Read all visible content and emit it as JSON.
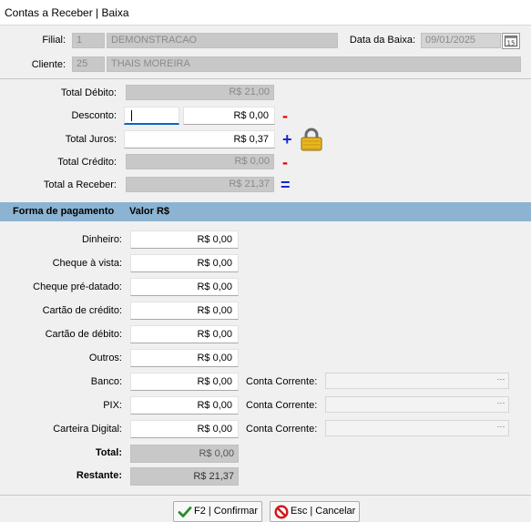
{
  "window": {
    "title": "Contas a Receber | Baixa"
  },
  "header": {
    "filial_label": "Filial:",
    "filial_code": "1",
    "filial_name": "DEMONSTRACAO",
    "data_label": "Data da Baixa:",
    "data_value": "09/01/2025",
    "calendar_text": "15",
    "cliente_label": "Cliente:",
    "cliente_code": "25",
    "cliente_name": "THAIS MOREIRA"
  },
  "totals": {
    "debito_label": "Total Débito:",
    "debito_value": "R$ 21,00",
    "desconto_label": "Desconto:",
    "desconto_percent": "",
    "desconto_value": "R$ 0,00",
    "juros_label": "Total Juros:",
    "juros_value": "R$ 0,37",
    "credito_label": "Total Crédito:",
    "credito_value": "R$ 0,00",
    "receber_label": "Total a Receber:",
    "receber_value": "R$ 21,37",
    "op_minus": "-",
    "op_plus": "+",
    "op_equals": "="
  },
  "payment": {
    "col_forma": "Forma de pagamento",
    "col_valor": "Valor R$",
    "rows": [
      {
        "label": "Dinheiro:",
        "value": "R$ 0,00"
      },
      {
        "label": "Cheque à vista:",
        "value": "R$ 0,00"
      },
      {
        "label": "Cheque pré-datado:",
        "value": "R$ 0,00"
      },
      {
        "label": "Cartão de crédito:",
        "value": "R$ 0,00"
      },
      {
        "label": "Cartão de débito:",
        "value": "R$ 0,00"
      },
      {
        "label": "Outros:",
        "value": "R$ 0,00"
      },
      {
        "label": "Banco:",
        "value": "R$ 0,00",
        "conta_label": "Conta Corrente:",
        "conta_value": ""
      },
      {
        "label": "PIX:",
        "value": "R$ 0,00",
        "conta_label": "Conta Corrente:",
        "conta_value": ""
      },
      {
        "label": "Carteira Digital:",
        "value": "R$ 0,00",
        "conta_label": "Conta Corrente:",
        "conta_value": ""
      }
    ],
    "ellipsis": "···",
    "total_label": "Total:",
    "total_value": "R$ 0,00",
    "restante_label": "Restante:",
    "restante_value": "R$ 21,37"
  },
  "buttons": {
    "confirm_label": "F2 | Confirmar",
    "cancel_label": "Esc | Cancelar"
  },
  "icons": {
    "lock": "lock-icon",
    "calendar": "calendar-icon",
    "check": "check-icon",
    "cancel": "cancel-icon"
  },
  "colors": {
    "section_band": "#8cb4d2",
    "readonly_bg": "#c8c8c8",
    "minus": "#e00000",
    "plus": "#1428c8",
    "focus": "#0a64c8"
  }
}
